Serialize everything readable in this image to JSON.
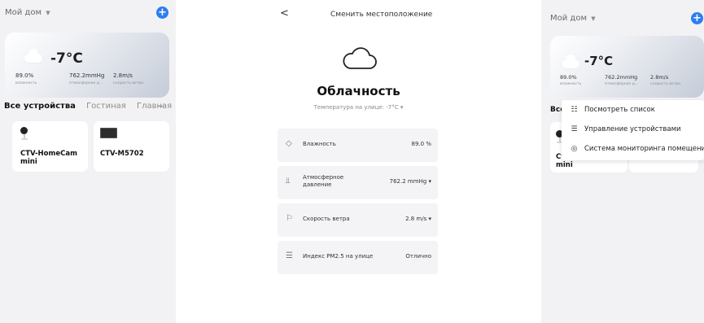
{
  "left": {
    "home_title": "Мой дом",
    "home_caret": "▼",
    "add_symbol": "+",
    "weather": {
      "temp": "-7°C",
      "humidity_value": "89.0%",
      "humidity_label": "Влажность",
      "pressure_value": "762.2mmHg",
      "pressure_label": "Атмосферное д...",
      "wind_value": "2.8m/s",
      "wind_label": "Скорость ветра"
    },
    "tabs": [
      "Все устройства",
      "Гостиная",
      "Главная"
    ],
    "more": "···",
    "devices": [
      {
        "name": "CTV-HomeCam mini",
        "icon": "camera-icon"
      },
      {
        "name": "CTV-M5702",
        "icon": "monitor-icon"
      }
    ]
  },
  "middle": {
    "back": "<",
    "title": "Сменить местоположение",
    "condition": "Облачность",
    "outside_temp": "Температура на улице: -7°C ▾",
    "rows": [
      {
        "icon": "drop-icon",
        "glyph": "◇",
        "label": "Влажность",
        "value": "89.0 %"
      },
      {
        "icon": "pressure-icon",
        "glyph": "⫫",
        "label": "Атмосферное давление",
        "value": "762.2 mmHg ▾"
      },
      {
        "icon": "flag-icon",
        "glyph": "⚐",
        "label": "Скорость ветра",
        "value": "2.8 m/s ▾"
      },
      {
        "icon": "pm25-icon",
        "glyph": "☰",
        "label": "Индекс PM2.5 на улице",
        "value": "Отлично"
      }
    ]
  },
  "right": {
    "home_title": "Мой дом",
    "home_caret": "▼",
    "add_symbol": "+",
    "weather": {
      "temp": "-7°C",
      "humidity_value": "89.0%",
      "humidity_label": "Влажность",
      "pressure_value": "762.2mmHg",
      "pressure_label": "Атмосферное д...",
      "wind_value": "2.8m/s",
      "wind_label": "Скорость ветра"
    },
    "tab_partial": "Все",
    "device_partial": "Ст mini",
    "menu": [
      {
        "icon": "grid-list-icon",
        "glyph": "☷",
        "label": "Посмотреть список"
      },
      {
        "icon": "manage-icon",
        "glyph": "☰",
        "label": "Управление устройствами"
      },
      {
        "icon": "monitor-system-icon",
        "glyph": "◎",
        "label": "Система мониторинга помещений"
      }
    ]
  },
  "colors": {
    "accent": "#2c7df0",
    "background": "#f2f2f4"
  }
}
